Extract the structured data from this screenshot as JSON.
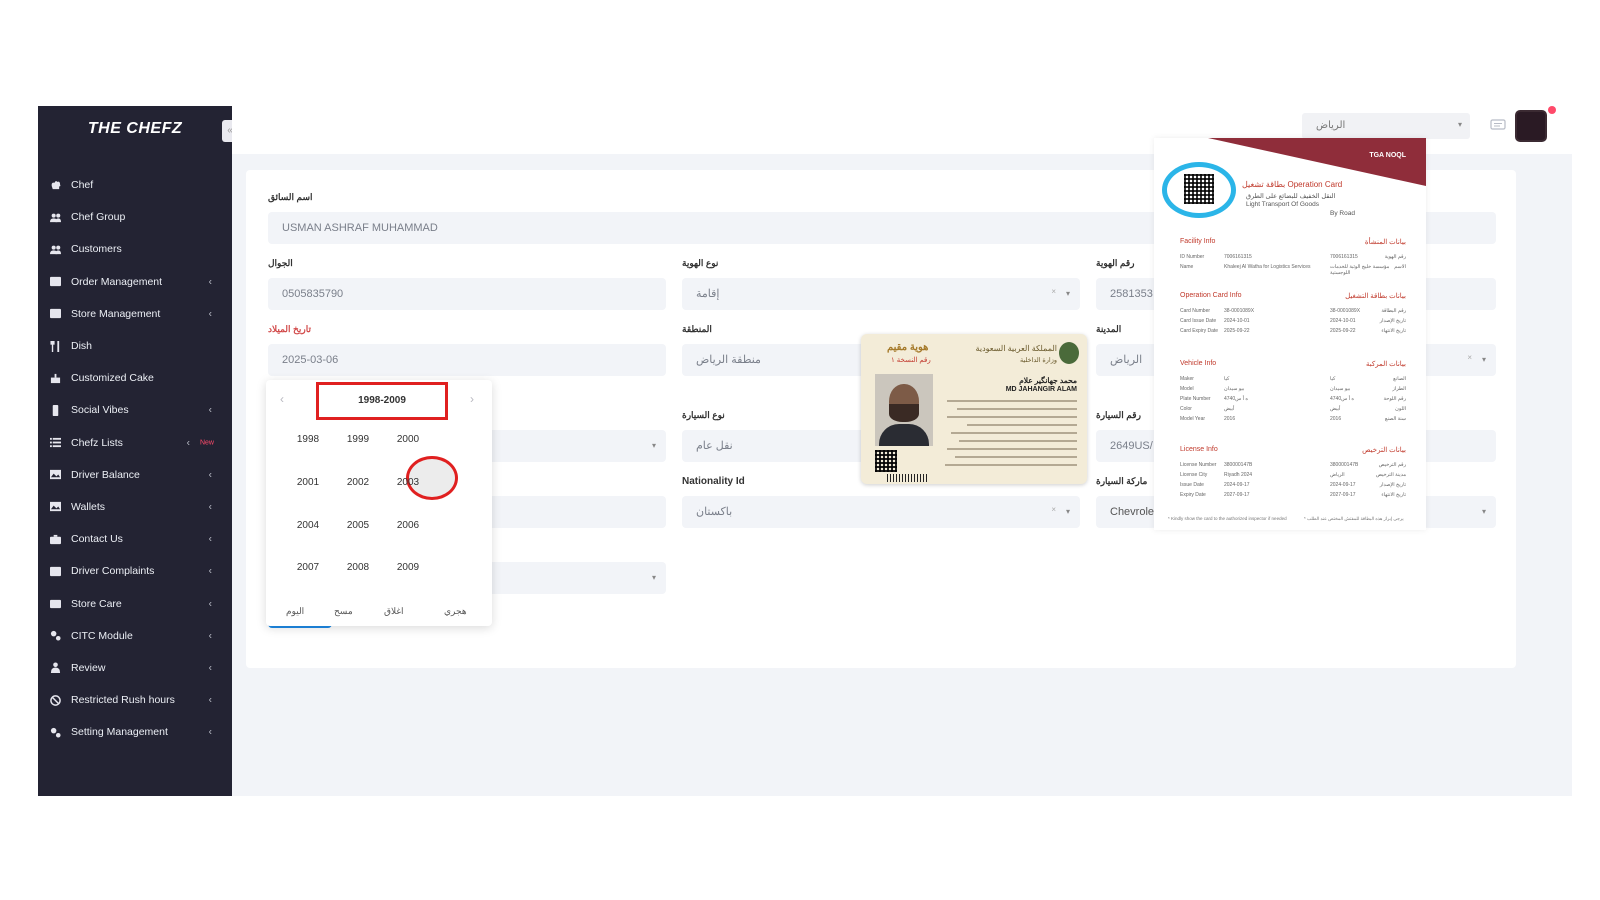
{
  "app": {
    "logo": "THE CHEFZ"
  },
  "sidebar": {
    "items": [
      {
        "label": "Chef",
        "icon": "chef-hat-icon",
        "chevron": false
      },
      {
        "label": "Chef Group",
        "icon": "users-icon",
        "chevron": false
      },
      {
        "label": "Customers",
        "icon": "users-icon",
        "chevron": false
      },
      {
        "label": "Order Management",
        "icon": "table-icon",
        "chevron": true
      },
      {
        "label": "Store Management",
        "icon": "table-icon",
        "chevron": true
      },
      {
        "label": "Dish",
        "icon": "cutlery-icon",
        "chevron": false
      },
      {
        "label": "Customized Cake",
        "icon": "cake-icon",
        "chevron": false
      },
      {
        "label": "Social Vibes",
        "icon": "phone-icon",
        "chevron": true
      },
      {
        "label": "Chefz Lists",
        "icon": "list-icon",
        "chevron": true,
        "badge": "New"
      },
      {
        "label": "Driver Balance",
        "icon": "image-icon",
        "chevron": true
      },
      {
        "label": "Wallets",
        "icon": "image-icon",
        "chevron": true
      },
      {
        "label": "Contact Us",
        "icon": "briefcase-icon",
        "chevron": true
      },
      {
        "label": "Driver Complaints",
        "icon": "table-icon",
        "chevron": true
      },
      {
        "label": "Store Care",
        "icon": "store-icon",
        "chevron": true
      },
      {
        "label": "CITC Module",
        "icon": "gears-icon",
        "chevron": true
      },
      {
        "label": "Review",
        "icon": "user-icon",
        "chevron": true
      },
      {
        "label": "Restricted Rush hours",
        "icon": "ban-icon",
        "chevron": true
      },
      {
        "label": "Setting Management",
        "icon": "gears-icon",
        "chevron": true
      }
    ]
  },
  "topbar": {
    "city": "الرياض"
  },
  "form": {
    "driver_name": {
      "label": "اسم السائق",
      "value": "USMAN ASHRAF MUHAMMAD"
    },
    "mobile": {
      "label": "الجوال",
      "value": "0505835790"
    },
    "id_type": {
      "label": "نوع الهوية",
      "value": "إقامة"
    },
    "id_number": {
      "label": "رقم الهوية",
      "value": "2581353"
    },
    "birth_date": {
      "label": "تاريخ الميلاد",
      "value": "2025-03-06"
    },
    "region": {
      "label": "المنطقة",
      "value": "منطقة الرياض"
    },
    "city": {
      "label": "المدينة",
      "value": "الرياض"
    },
    "car_type": {
      "label": "نوع السيارة",
      "value": "نقل عام"
    },
    "car_number": {
      "label": "رقم السيارة",
      "value": "2649US/"
    },
    "nationality": {
      "label": "Nationality Id",
      "value": "باكستان"
    },
    "car_brand": {
      "label": "ماركة السيارة",
      "value": "Chevrolet"
    }
  },
  "datepicker": {
    "range": "1998-2009",
    "years": [
      "1998",
      "1999",
      "2000",
      "2001",
      "2002",
      "2003",
      "2004",
      "2005",
      "2006",
      "2007",
      "2008",
      "2009"
    ],
    "selected": "2003",
    "footer": [
      "اليوم",
      "مسح",
      "اغلاق",
      "هجري"
    ]
  },
  "id_card": {
    "title": "هوية مقيم",
    "subtitle": "رقم النسخة ١",
    "ministry": "المملكة العربية السعودية",
    "ministry_sub": "وزارة الداخلية",
    "name_ar": "محمد جهانگیر علام",
    "name_en": "MD JAHANGIR ALAM"
  },
  "operation_card": {
    "logo": "TGA NOQL",
    "title": "بطاقة تشغيل Operation Card",
    "subtitle1": "النقل الخفيف للبضائع على الطرق",
    "subtitle2": "Light Transport Of Goods",
    "subtitle3": "By Road",
    "sections": [
      {
        "en": "Facility Info",
        "ar": "بيانات المنشأة",
        "rows": [
          [
            "ID Number",
            "7006161315",
            "7006161315",
            "رقم الهوية"
          ],
          [
            "Name",
            "Khaleej Al Watha for Logistics Services",
            "مؤسسة خليج الوثبة للخدمات اللوجستية",
            "الاسم"
          ]
        ]
      },
      {
        "en": "Operation Card Info",
        "ar": "بيانات بطاقة التشغيل",
        "rows": [
          [
            "Card Number",
            "38-0001089X",
            "38-0001089X",
            "رقم البطاقة"
          ],
          [
            "Card Issue Date",
            "2024-10-01",
            "2024-10-01",
            "تاريخ الإصدار"
          ],
          [
            "Card Expiry Date",
            "2025-09-22",
            "2025-09-22",
            "تاريخ الانتهاء"
          ]
        ]
      },
      {
        "en": "Vehicle Info",
        "ar": "بيانات المركبة",
        "rows": [
          [
            "Maker",
            "كيا",
            "كيا",
            "الصانع"
          ],
          [
            "Model",
            "بيو سيدان",
            "بيو سيدان",
            "الطراز"
          ],
          [
            "Plate Number",
            "4740ه أ س",
            "4740ه أ س",
            "رقم اللوحة"
          ],
          [
            "Color",
            "أبيض",
            "أبيض",
            "اللون"
          ],
          [
            "Model Year",
            "2016",
            "2016",
            "سنة الصنع"
          ]
        ]
      },
      {
        "en": "License Info",
        "ar": "بيانات الترخيص",
        "rows": [
          [
            "License Number",
            "380000147B",
            "380000147B",
            "رقم الترخيص"
          ],
          [
            "License City",
            "Riyadh 2024",
            "الرياض",
            "مدينة الترخيص"
          ],
          [
            "Issue Date",
            "2024-09-17",
            "2024-09-17",
            "تاريخ الإصدار"
          ],
          [
            "Expiry Date",
            "2027-09-17",
            "2027-09-17",
            "تاريخ الانتهاء"
          ]
        ]
      }
    ],
    "footer_en": "* Kindly show the card to the authorized inspector if needed",
    "footer_ar": "* يرجى إبراز هذه البطاقة للمفتش المختص عند الطلب"
  },
  "colors": {
    "sidebar_bg": "#232333",
    "accent_red": "#e02020",
    "annotation_blue": "#2bb5e8",
    "primary_button": "#1e8ae6",
    "card_banner": "#8f2d3a"
  }
}
